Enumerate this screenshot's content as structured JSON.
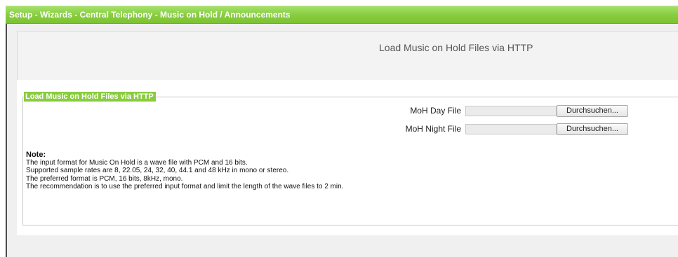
{
  "title_bar": {
    "text": "Setup - Wizards - Central Telephony - Music on Hold / Announcements"
  },
  "header": {
    "title": "Load Music on Hold Files via HTTP"
  },
  "form": {
    "legend": "Load Music on Hold Files via HTTP",
    "day_file": {
      "label": "MoH Day File",
      "value": "",
      "button_label": "Durchsuchen..."
    },
    "night_file": {
      "label": "MoH Night File",
      "value": "",
      "button_label": "Durchsuchen..."
    }
  },
  "note": {
    "title": "Note:",
    "lines": [
      "The input format for Music On Hold is a wave file with PCM and 16 bits.",
      "Supported sample rates are 8, 22.05, 24, 32, 40, 44.1 and 48 kHz in mono or stereo.",
      "The preferred format is PCM, 16 bits, 8kHz, mono.",
      "The recommendation is to use the preferred input format and limit the length of the wave files to 2 min."
    ]
  },
  "colors": {
    "title_bar_green": "#86cc3e",
    "legend_green": "#8acc3f",
    "panel_gray": "#f0f0f0"
  }
}
